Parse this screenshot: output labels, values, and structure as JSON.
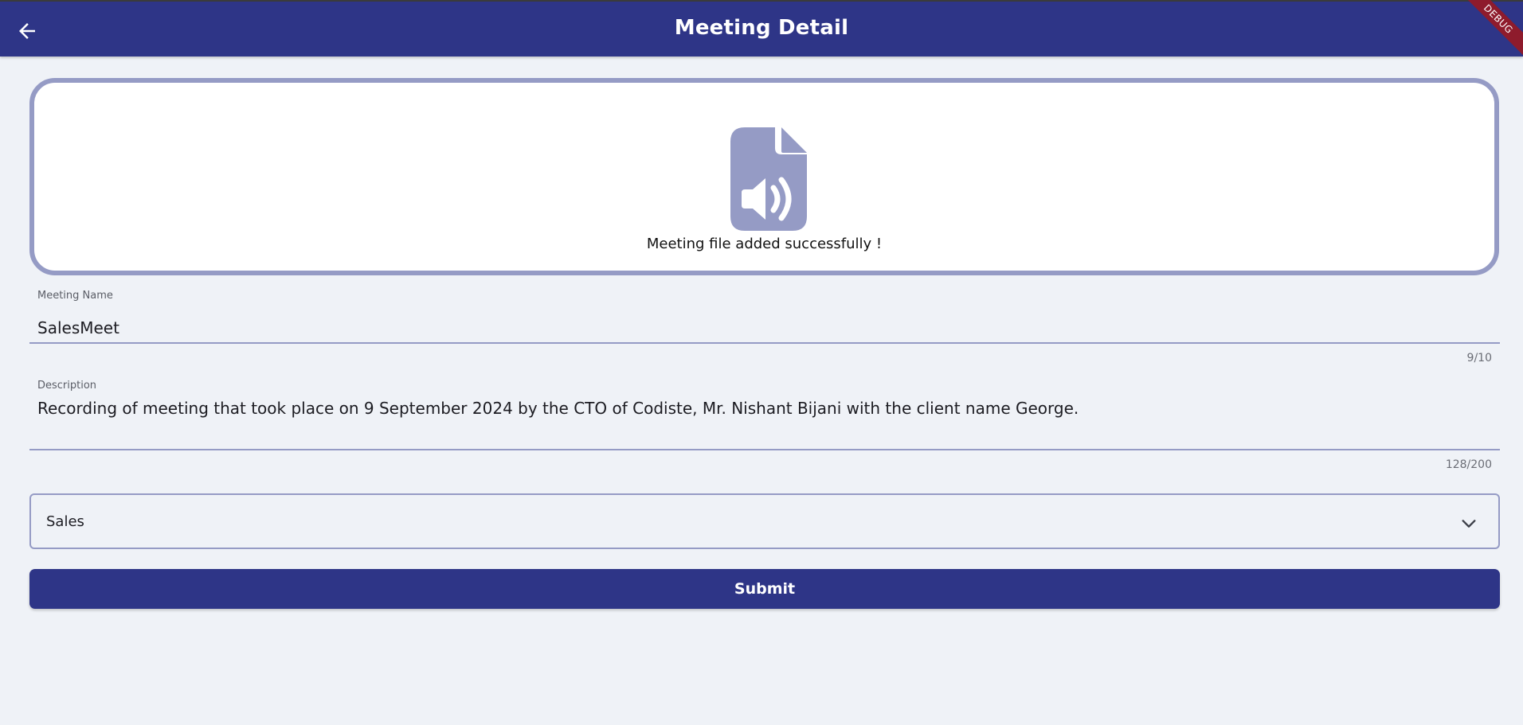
{
  "appbar": {
    "title": "Meeting Detail",
    "back_icon": "arrow-left-icon",
    "debug_label": "DEBUG",
    "color": "#2e3587"
  },
  "upload": {
    "icon": "audio-file-icon",
    "message": "Meeting file added successfully !",
    "border_color": "#959bc5"
  },
  "meeting_name": {
    "label": "Meeting Name",
    "value": "SalesMeet",
    "counter": "9/10"
  },
  "description": {
    "label": "Description",
    "value": "Recording of meeting that took place on 9 September 2024 by the CTO of Codiste, Mr. Nishant Bijani with the client name George.",
    "counter": "128/200"
  },
  "category": {
    "selected": "Sales",
    "icon": "chevron-down-icon"
  },
  "submit": {
    "label": "Submit"
  }
}
